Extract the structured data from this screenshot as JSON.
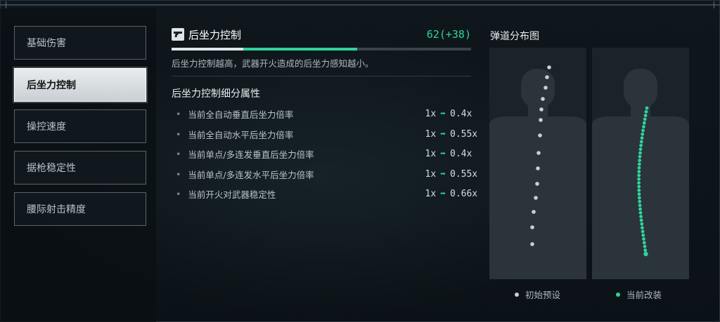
{
  "sidebar": {
    "items": [
      {
        "label": "基础伤害",
        "active": false
      },
      {
        "label": "后坐力控制",
        "active": true
      },
      {
        "label": "操控速度",
        "active": false
      },
      {
        "label": "据枪稳定性",
        "active": false
      },
      {
        "label": "腰际射击精度",
        "active": false
      }
    ]
  },
  "main": {
    "icon": "gun-icon",
    "title": "后坐力控制",
    "score": "62(+38)",
    "progress": {
      "base": 24,
      "bonus": 38,
      "max": 100
    },
    "description": "后坐力控制越高，武器开火造成的后坐力感知越小。",
    "breakdown_title": "后坐力控制细分属性",
    "rows": [
      {
        "label": "当前全自动垂直后坐力倍率",
        "from": "1x",
        "to": "0.4x"
      },
      {
        "label": "当前全自动水平后坐力倍率",
        "from": "1x",
        "to": "0.55x"
      },
      {
        "label": "当前单点/多连发垂直后坐力倍率",
        "from": "1x",
        "to": "0.4x"
      },
      {
        "label": "当前单点/多连发水平后坐力倍率",
        "from": "1x",
        "to": "0.55x"
      },
      {
        "label": "当前开火对武器稳定性",
        "from": "1x",
        "to": "0.66x"
      }
    ]
  },
  "spread": {
    "title": "弹道分布图",
    "legend_default": "初始预设",
    "legend_current": "当前改装",
    "colors": {
      "default": "#c9cfd3",
      "current": "#2fd39a",
      "accent": "#2fd39a"
    }
  }
}
